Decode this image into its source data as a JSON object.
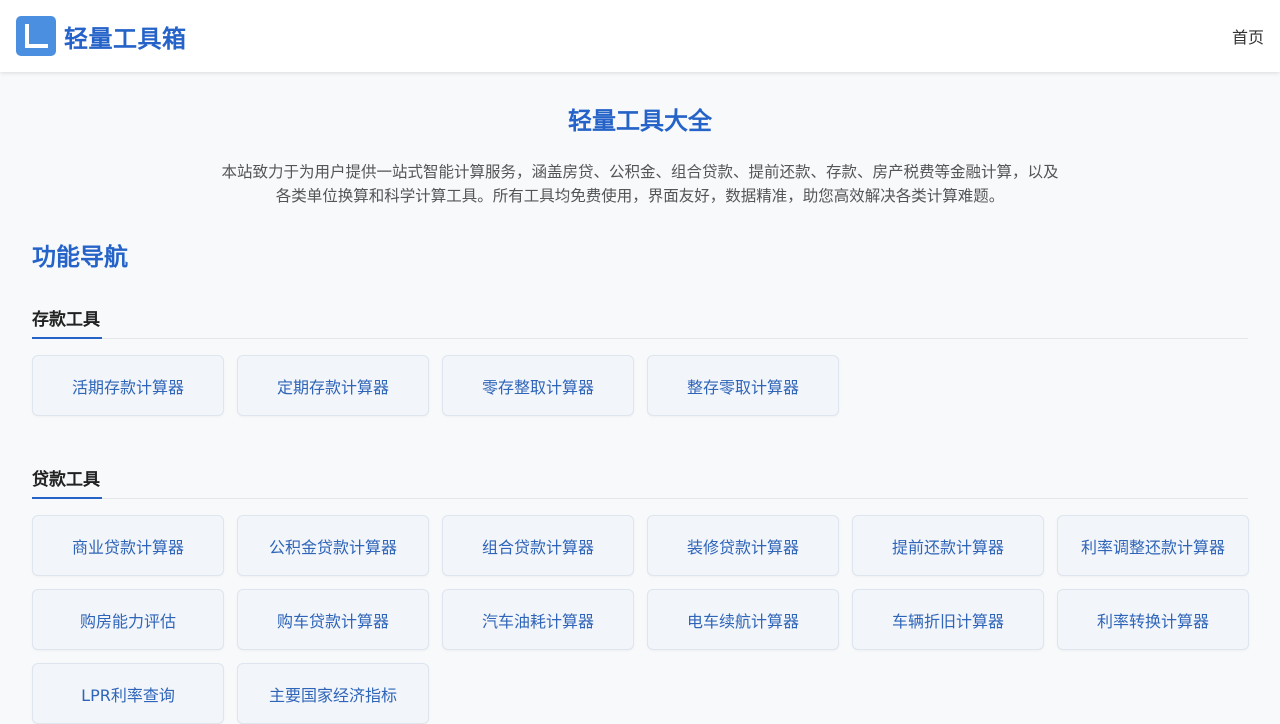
{
  "header": {
    "brand_name": "轻量工具箱",
    "nav_home": "首页"
  },
  "main": {
    "title": "轻量工具大全",
    "intro_line1": "本站致力于为用户提供一站式智能计算服务，涵盖房贷、公积金、组合贷款、提前还款、存款、房产税费等金融计算，以及",
    "intro_line2": "各类单位换算和科学计算工具。所有工具均免费使用，界面友好，数据精准，助您高效解决各类计算难题。",
    "section_title": "功能导航",
    "groups": [
      {
        "title": "存款工具",
        "items": [
          "活期存款计算器",
          "定期存款计算器",
          "零存整取计算器",
          "整存零取计算器"
        ]
      },
      {
        "title": "贷款工具",
        "items": [
          "商业贷款计算器",
          "公积金贷款计算器",
          "组合贷款计算器",
          "装修贷款计算器",
          "提前还款计算器",
          "利率调整还款计算器",
          "购房能力评估",
          "购车贷款计算器",
          "汽车油耗计算器",
          "电车续航计算器",
          "车辆折旧计算器",
          "利率转换计算器",
          "LPR利率查询",
          "主要国家经济指标"
        ]
      }
    ]
  },
  "colors": {
    "accent": "#2563c9",
    "logo_bg": "#4a8fe0",
    "page_bg": "#f7f9fb",
    "button_bg": "#f2f5fa"
  }
}
